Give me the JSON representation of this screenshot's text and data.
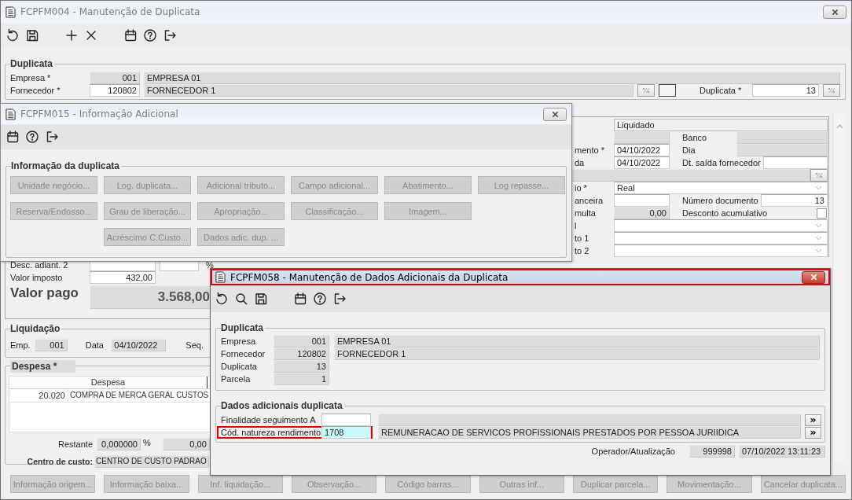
{
  "main_window": {
    "title": "FCPFM004 - Manutenção de Duplicata",
    "active": false,
    "duplicata": {
      "legend": "Duplicata",
      "empresa": {
        "label": "Empresa *",
        "code": "001",
        "name": "EMPRESA 01"
      },
      "fornecedor": {
        "label": "Fornecedor *",
        "code": "120802",
        "name": "FORNECEDOR 1"
      },
      "duplicata": {
        "label": "Duplicata *",
        "value": "13"
      }
    },
    "detail_rows": [
      {
        "kind": "status",
        "value": "Liquidado"
      },
      {
        "kind": "pair",
        "left_readonly": true,
        "label2": "Banco",
        "right_readonly": true
      },
      {
        "kind": "pair",
        "label": "mento *",
        "left_value": "04/10/2022",
        "left_readonly": false,
        "label2": "Dia",
        "right_readonly": true
      },
      {
        "kind": "pair",
        "label": "da",
        "left_value": "04/10/2022",
        "left_readonly": false,
        "label2": "Dt. saída fornecedor",
        "right_readonly": false
      },
      {
        "kind": "lookup"
      },
      {
        "kind": "select",
        "label": "io *",
        "value": "Real"
      },
      {
        "kind": "pair",
        "label": "anceira",
        "left_readonly": false,
        "label2": "Número documento",
        "right_value": "13",
        "right_readonly": false
      },
      {
        "kind": "check",
        "label": "multa",
        "left_value": "0,00",
        "left_readonly": true,
        "label2": "Desconto acumulativo",
        "checked": false
      },
      {
        "kind": "select",
        "label": "l"
      },
      {
        "kind": "select",
        "label": "to 1"
      },
      {
        "kind": "select",
        "label": "to 2"
      }
    ],
    "desc_adiant_2": {
      "label": "Desc. adiant. 2",
      "unit": "%"
    },
    "valor_imposto": {
      "label": "Valor imposto",
      "value": "432,00"
    },
    "valor_pago": {
      "label": "Valor pago",
      "value": "3.568,00"
    },
    "liquidacao": {
      "legend": "Liquidação",
      "emp_label": "Emp.",
      "emp": "001",
      "data_label": "Data",
      "data": "04/10/2022",
      "seq_label": "Seq."
    },
    "despesa": {
      "legend": "Despesa *",
      "columns": [
        "Despesa"
      ],
      "rows": [
        {
          "code": "20.020",
          "name": "COMPRA DE MERCA GERAL CUSTOS"
        }
      ],
      "restante_label": "Restante",
      "restante_pct": "0,000000",
      "pct_unit": "%",
      "restante_value": "0,00",
      "centro_label": "Centro de custo:",
      "centro_value": "CENTRO DE CUSTO PADRAO"
    },
    "buttons": [
      {
        "label": "Informação origem...",
        "disabled": true
      },
      {
        "label": "Informação baixa...",
        "disabled": true
      },
      {
        "label": "Inf. liquidação...",
        "disabled": true
      },
      {
        "label": "Observação...",
        "disabled": true
      },
      {
        "label": "Código barras...",
        "disabled": true
      },
      {
        "label": "Outras inf...",
        "disabled": true
      },
      {
        "label": "Duplicar parcela...",
        "disabled": true
      },
      {
        "label": "Movimentação...",
        "disabled": true
      },
      {
        "label": "Cancelar duplicata...",
        "disabled": true
      }
    ]
  },
  "info_dialog": {
    "title": "FCPFM015 - Informação Adicional",
    "active": false,
    "legend": "Informação da duplicata",
    "button_rows": [
      [
        {
          "label": "Unidade negócio...",
          "disabled": true
        },
        {
          "label": "Log. duplicata...",
          "disabled": true
        },
        {
          "label": "Adicional tributo...",
          "disabled": true
        },
        {
          "label": "Campo adicional...",
          "disabled": true
        },
        {
          "label": "Abatimento...",
          "disabled": true
        },
        {
          "label": "Log repasse...",
          "disabled": true
        }
      ],
      [
        {
          "label": "Reserva/Endosso...",
          "disabled": true
        },
        {
          "label": "Grau de liberação...",
          "disabled": true
        },
        {
          "label": "Apropriação...",
          "disabled": true
        },
        {
          "label": "Classificação...",
          "disabled": true
        },
        {
          "label": "Imagem...",
          "disabled": true
        }
      ],
      [
        {
          "label": "Acréscimo C.Custo...",
          "disabled": true
        },
        {
          "label": "Dados adic. dup. ...",
          "disabled": true
        }
      ]
    ]
  },
  "dados_dialog": {
    "title": "FCPFM058 - Manutenção de Dados Adicionais da Duplicata",
    "active": true,
    "highlighted": true,
    "duplicata": {
      "legend": "Duplicata",
      "rows": [
        {
          "label": "Empresa",
          "code": "001",
          "name": "EMPRESA 01"
        },
        {
          "label": "Fornecedor",
          "code": "120802",
          "name": "FORNECEDOR 1"
        },
        {
          "label": "Duplicata",
          "code": "13"
        },
        {
          "label": "Parcela",
          "code": "1"
        }
      ]
    },
    "dados": {
      "legend": "Dados adicionais duplicata",
      "rows": [
        {
          "label": "Finalidade seguimento A",
          "focused": false,
          "highlighted": false,
          "button": "»"
        },
        {
          "label": "Cód. natureza rendimento",
          "value": "1708",
          "description": "REMUNERACAO DE SERVICOS PROFISSIONAIS PRESTADOS POR PESSOA JURIIDICA",
          "focused": true,
          "highlighted": true,
          "button": "»"
        }
      ]
    },
    "operador": {
      "label": "Operador/Atualização",
      "code": "999998",
      "timestamp": "07/10/2022 13:11:23"
    }
  }
}
